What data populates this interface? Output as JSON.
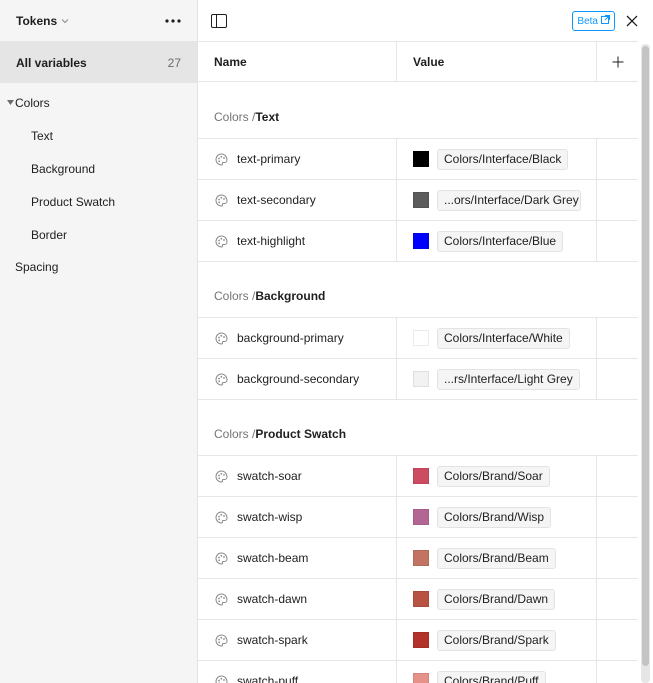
{
  "sidebar": {
    "title": "Tokens",
    "all_label": "All variables",
    "all_count": "27",
    "group_label": "Colors",
    "items": [
      {
        "label": "Text"
      },
      {
        "label": "Background"
      },
      {
        "label": "Product Swatch"
      },
      {
        "label": "Border"
      }
    ],
    "spacing_label": "Spacing"
  },
  "topbar": {
    "beta_label": "Beta"
  },
  "table": {
    "header_name": "Name",
    "header_value": "Value",
    "groups": [
      {
        "prefix": "Colors / ",
        "name": "Text",
        "rows": [
          {
            "name": "text-primary",
            "value": "Colors/Interface/Black",
            "color": "#000000"
          },
          {
            "name": "text-secondary",
            "value": "...ors/Interface/Dark Grey",
            "color": "#5c5c5c"
          },
          {
            "name": "text-highlight",
            "value": "Colors/Interface/Blue",
            "color": "#0000ff"
          }
        ]
      },
      {
        "prefix": "Colors / ",
        "name": "Background",
        "rows": [
          {
            "name": "background-primary",
            "value": "Colors/Interface/White",
            "color": "#ffffff"
          },
          {
            "name": "background-secondary",
            "value": "...rs/Interface/Light Grey",
            "color": "#f2f2f2"
          }
        ]
      },
      {
        "prefix": "Colors / ",
        "name": "Product Swatch",
        "rows": [
          {
            "name": "swatch-soar",
            "value": "Colors/Brand/Soar",
            "color": "#cc4d61"
          },
          {
            "name": "swatch-wisp",
            "value": "Colors/Brand/Wisp",
            "color": "#b36693"
          },
          {
            "name": "swatch-beam",
            "value": "Colors/Brand/Beam",
            "color": "#c27361"
          },
          {
            "name": "swatch-dawn",
            "value": "Colors/Brand/Dawn",
            "color": "#b85242"
          },
          {
            "name": "swatch-spark",
            "value": "Colors/Brand/Spark",
            "color": "#b3332b"
          },
          {
            "name": "swatch-puff",
            "value": "Colors/Brand/Puff",
            "color": "#e6918a"
          }
        ]
      }
    ]
  },
  "icons": {
    "caret": "chevron-down-icon",
    "more": "more-horizontal-icon",
    "panel": "sidebar-panel-icon",
    "external": "external-link-icon",
    "close": "close-icon",
    "add": "plus-icon",
    "variable": "palette-icon"
  },
  "colors": {
    "accent": "#0d99ff",
    "sidebar_bg": "#f5f5f5",
    "selected_bg": "#e5e5e5"
  }
}
